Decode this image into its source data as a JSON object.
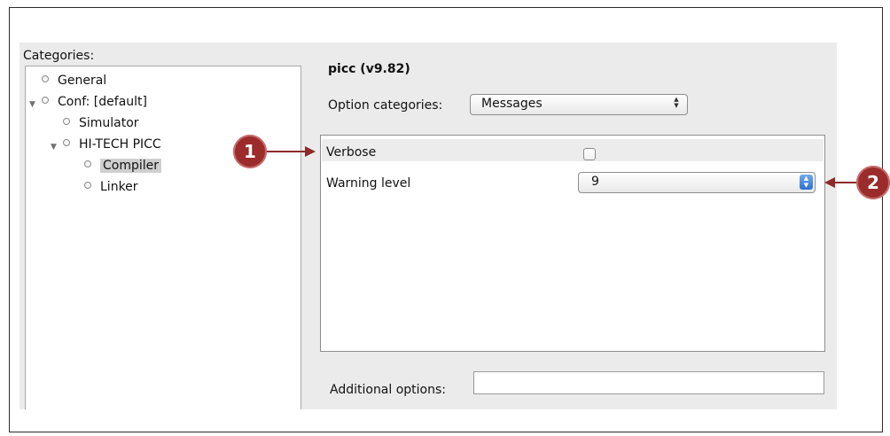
{
  "categories_label": "Categories:",
  "tree": {
    "general": "General",
    "conf": "Conf: [default]",
    "simulator": "Simulator",
    "hitech": "HI-TECH PICC",
    "compiler": "Compiler",
    "linker": "Linker"
  },
  "title": "picc (v9.82)",
  "option_categories": {
    "label": "Option categories:",
    "value": "Messages"
  },
  "options": {
    "verbose": {
      "label": "Verbose",
      "checked": false
    },
    "warning_level": {
      "label": "Warning level",
      "value": "9"
    }
  },
  "additional_options": {
    "label": "Additional options:",
    "value": ""
  },
  "callouts": {
    "one": "1",
    "two": "2"
  },
  "colors": {
    "callout": "#9c2b2b",
    "arrow": "#8e2a2a",
    "stepper_blue": "#3a7bd5"
  }
}
